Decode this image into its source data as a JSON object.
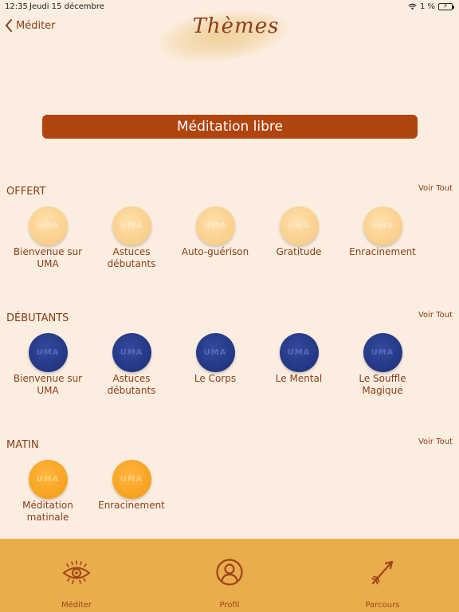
{
  "status_bar": {
    "time": "12:35",
    "date": "Jeudi 15 décembre",
    "battery": "1 %"
  },
  "nav": {
    "back_label": "Méditer",
    "title": "Thèmes"
  },
  "free_button": {
    "label": "Méditation libre"
  },
  "sections": [
    {
      "title": "OFFERT",
      "see_all": "Voir Tout",
      "items": [
        "Bienvenue sur UMA",
        "Astuces débutants",
        "Auto-guérison",
        "Gratitude",
        "Enracinement"
      ]
    },
    {
      "title": "DÉBUTANTS",
      "see_all": "Voir Tout",
      "items": [
        "Bienvenue sur UMA",
        "Astuces débutants",
        "Le Corps",
        "Le Mental",
        "Le Souffle Magique"
      ]
    },
    {
      "title": "MATIN",
      "see_all": "Voir Tout",
      "items": [
        "Méditation matinale",
        "Enracinement"
      ]
    }
  ],
  "circle_text": "UMA",
  "tabs": [
    {
      "label": "Méditer",
      "icon": "eye-icon"
    },
    {
      "label": "Profil",
      "icon": "profile-icon"
    },
    {
      "label": "Parcours",
      "icon": "arrow-icon"
    }
  ],
  "colors": {
    "background": "#fbeee0",
    "accent": "#b0450f",
    "tabbar": "#e9ad4c",
    "offert": "#f9ce8a",
    "debutants": "#223683",
    "matin": "#f6a21f"
  }
}
